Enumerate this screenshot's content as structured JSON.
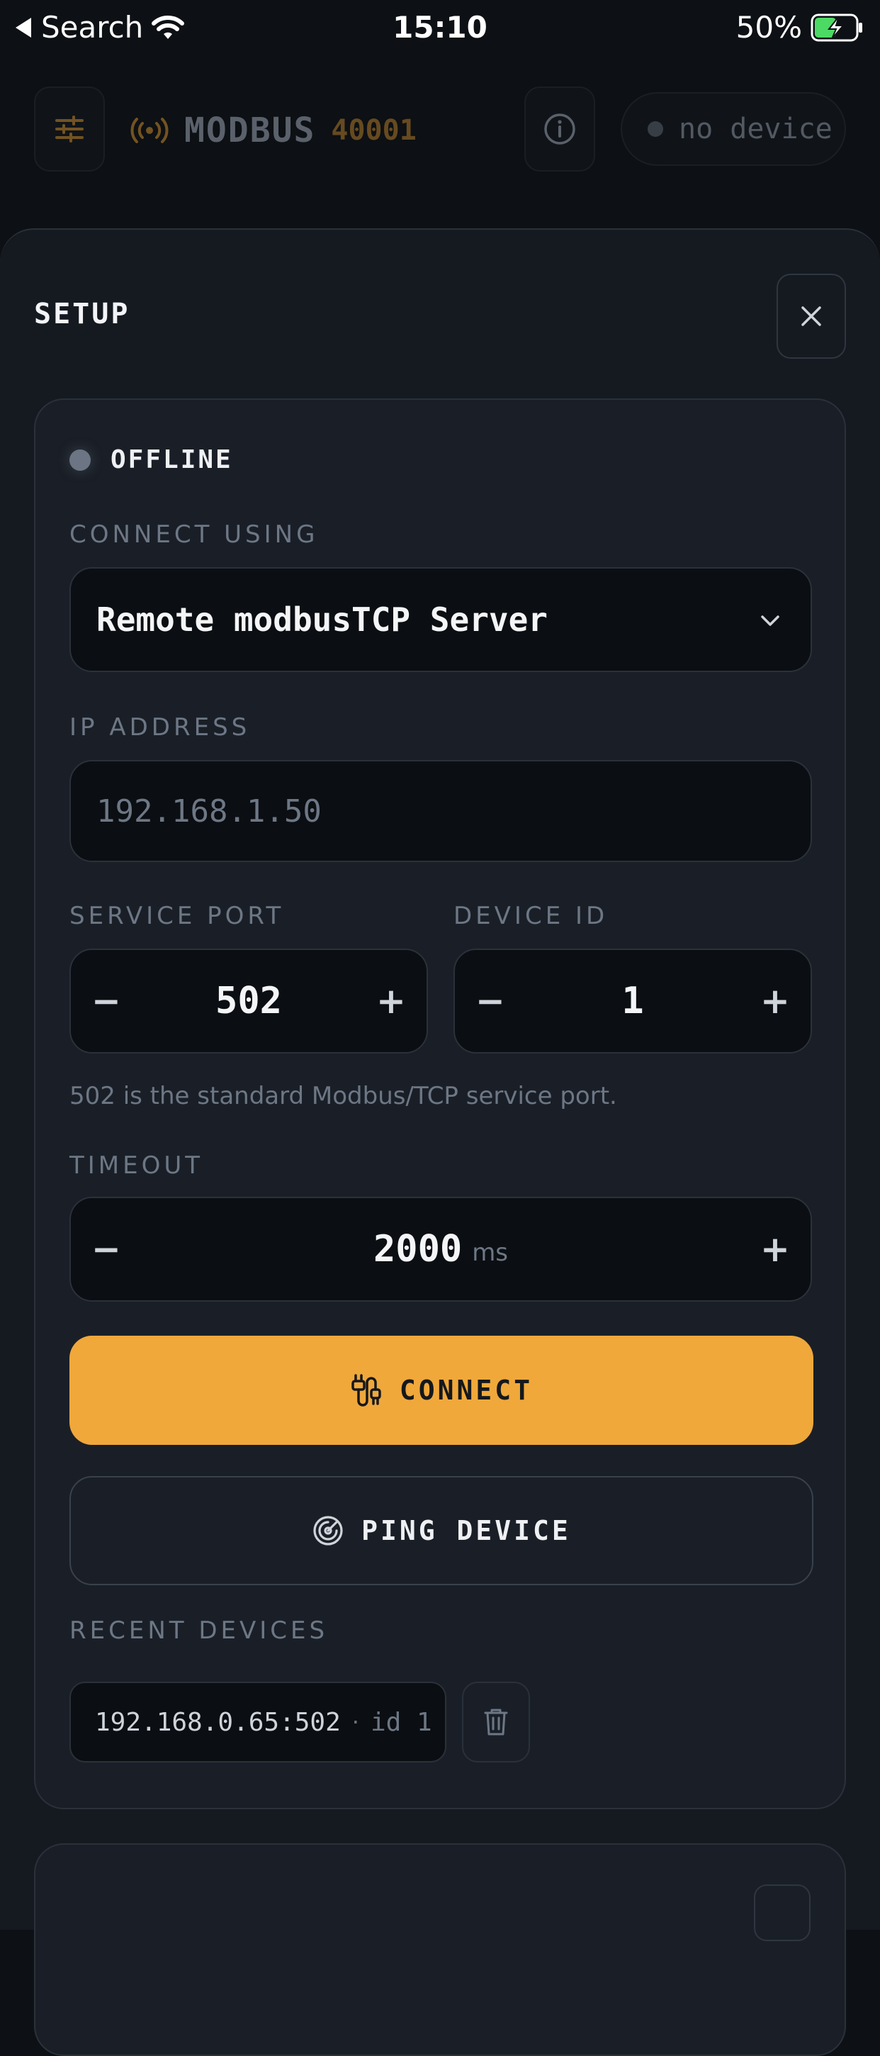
{
  "status_bar": {
    "back_label": "Search",
    "time": "15:10",
    "battery_percent": "50%"
  },
  "header": {
    "title": "MODBUS",
    "register": "40001",
    "device_status": "no device"
  },
  "setup": {
    "title": "SETUP",
    "connection_status": "OFFLINE",
    "connect_using_label": "CONNECT USING",
    "connect_using_value": "Remote modbusTCP Server",
    "ip_label": "IP ADDRESS",
    "ip_placeholder": "192.168.1.50",
    "port_label": "SERVICE PORT",
    "port_value": "502",
    "device_id_label": "DEVICE ID",
    "device_id_value": "1",
    "port_hint": "502 is the standard Modbus/TCP service port.",
    "timeout_label": "TIMEOUT",
    "timeout_value": "2000",
    "timeout_unit": "ms",
    "connect_label": "CONNECT",
    "ping_label": "PING DEVICE",
    "recent_label": "RECENT DEVICES",
    "recent_devices": [
      {
        "address": "192.168.0.65:502",
        "separator": "·",
        "id": "id 1"
      }
    ],
    "stepper_minus": "−",
    "stepper_plus": "+"
  },
  "colors": {
    "accent": "#f0a83b",
    "background": "#0d1014",
    "sheet": "#151a21",
    "offline_dot": "#6c7584"
  }
}
